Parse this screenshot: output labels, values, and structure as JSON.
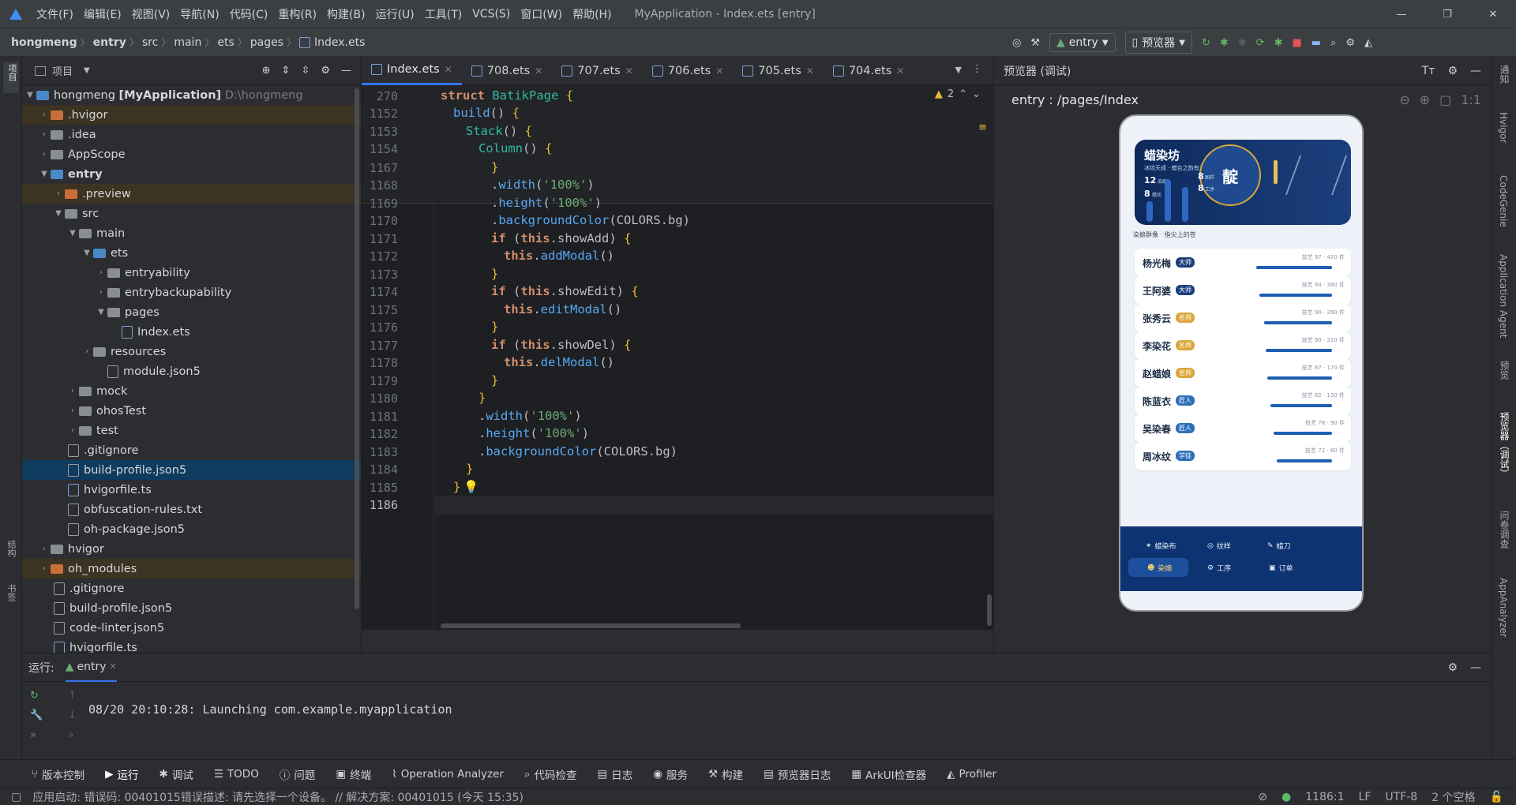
{
  "title_bar": {
    "menu": [
      "文件(F)",
      "编辑(E)",
      "视图(V)",
      "导航(N)",
      "代码(C)",
      "重构(R)",
      "构建(B)",
      "运行(U)",
      "工具(T)",
      "VCS(S)",
      "窗口(W)",
      "帮助(H)"
    ],
    "window_title": "MyApplication - Index.ets [entry]"
  },
  "nav_bar": {
    "breadcrumb": [
      "hongmeng",
      "entry",
      "src",
      "main",
      "ets",
      "pages",
      "Index.ets"
    ],
    "run_config": "entry",
    "device": "预览器"
  },
  "left_stripe": {
    "project_label": "项目",
    "structure_label": "结构",
    "bookmarks_label": "书签"
  },
  "project_panel": {
    "header": "项目",
    "tree": [
      {
        "label": "hongmeng",
        "bold": "[MyApplication]",
        "extra": "D:\\hongmeng"
      },
      {
        "label": ".hvigor"
      },
      {
        "label": ".idea"
      },
      {
        "label": "AppScope"
      },
      {
        "label": "entry"
      },
      {
        "label": ".preview"
      },
      {
        "label": "src"
      },
      {
        "label": "main"
      },
      {
        "label": "ets"
      },
      {
        "label": "entryability"
      },
      {
        "label": "entrybackupability"
      },
      {
        "label": "pages"
      },
      {
        "label": "Index.ets"
      },
      {
        "label": "resources"
      },
      {
        "label": "module.json5"
      },
      {
        "label": "mock"
      },
      {
        "label": "ohosTest"
      },
      {
        "label": "test"
      },
      {
        "label": ".gitignore"
      },
      {
        "label": "build-profile.json5"
      },
      {
        "label": "hvigorfile.ts"
      },
      {
        "label": "obfuscation-rules.txt"
      },
      {
        "label": "oh-package.json5"
      },
      {
        "label": "hvigor"
      },
      {
        "label": "oh_modules"
      },
      {
        "label": ".gitignore"
      },
      {
        "label": "build-profile.json5"
      },
      {
        "label": "code-linter.json5"
      },
      {
        "label": "hvigorfile.ts"
      }
    ]
  },
  "editor_tabs": [
    "Index.ets",
    "708.ets",
    "707.ets",
    "706.ets",
    "705.ets",
    "704.ets"
  ],
  "editor": {
    "warning_count": "2",
    "sticky_lines": [
      {
        "n": "270",
        "text": "struct BatikPage {"
      },
      {
        "n": "1152",
        "text": "build() {"
      },
      {
        "n": "1153",
        "text": "Stack() {"
      },
      {
        "n": "1154",
        "text": "Column() {"
      }
    ],
    "lines": [
      {
        "n": "1167",
        "text": "}"
      },
      {
        "n": "1168",
        "text": ".width('100%')"
      },
      {
        "n": "1169",
        "text": ".height('100%')"
      },
      {
        "n": "1170",
        "text": ".backgroundColor(COLORS.bg)"
      },
      {
        "n": "1171",
        "text": "if (this.showAdd) {"
      },
      {
        "n": "1172",
        "text": "this.addModal()"
      },
      {
        "n": "1173",
        "text": "}"
      },
      {
        "n": "1174",
        "text": "if (this.showEdit) {"
      },
      {
        "n": "1175",
        "text": "this.editModal()"
      },
      {
        "n": "1176",
        "text": "}"
      },
      {
        "n": "1177",
        "text": "if (this.showDel) {"
      },
      {
        "n": "1178",
        "text": "this.delModal()"
      },
      {
        "n": "1179",
        "text": "}"
      },
      {
        "n": "1180",
        "text": "}"
      },
      {
        "n": "1181",
        "text": ".width('100%')"
      },
      {
        "n": "1182",
        "text": ".height('100%')"
      },
      {
        "n": "1183",
        "text": ".backgroundColor(COLORS.bg)"
      },
      {
        "n": "1184",
        "text": "}"
      },
      {
        "n": "1185",
        "text": "}"
      },
      {
        "n": "1186",
        "text": ""
      }
    ]
  },
  "previewer": {
    "header": "预览器 (调试)",
    "path": "entry : /pages/Index",
    "app": {
      "banner_title": "蜡染坊",
      "banner_subtitle": "冰纹天成 · 蜡台之韵有天美",
      "seal": "靛",
      "stats": [
        "12",
        "8",
        "8",
        "8"
      ],
      "stat_labels": [
        "染娘",
        "蜡坊",
        "图样",
        "工序"
      ],
      "section_title": "染娘群像 · 指尖上的苍",
      "artisans": [
        {
          "name": "杨光梅",
          "badge": "大师",
          "badge_color": "#1b3f7c",
          "meta": "技艺 97 · 420 件"
        },
        {
          "name": "王阿婆",
          "badge": "大师",
          "badge_color": "#1b3f7c",
          "meta": "技艺 94 · 380 件"
        },
        {
          "name": "张秀云",
          "badge": "名师",
          "badge_color": "#d9a73a",
          "meta": "技艺 90 · 260 件"
        },
        {
          "name": "李染花",
          "badge": "名师",
          "badge_color": "#d9a73a",
          "meta": "技艺 90 · 210 件"
        },
        {
          "name": "赵蜡娘",
          "badge": "名师",
          "badge_color": "#d9a73a",
          "meta": "技艺 87 · 170 件"
        },
        {
          "name": "陈蓝衣",
          "badge": "匠人",
          "badge_color": "#2d6fb8",
          "meta": "技艺 82 · 130 件"
        },
        {
          "name": "吴染春",
          "badge": "匠人",
          "badge_color": "#2d6fb8",
          "meta": "技艺 78 · 90 件"
        },
        {
          "name": "周冰纹",
          "badge": "学徒",
          "badge_color": "#2d6fb8",
          "meta": "技艺 72 · 60 件"
        }
      ],
      "nav_items": [
        "蜡染布",
        "纹样",
        "蜡刀",
        "染娘",
        "工序",
        "订单"
      ]
    }
  },
  "right_stripe": [
    "通知",
    "Hvigor",
    "CodeGenie",
    "Application Agent",
    "预览",
    "预览器（调试）",
    "问卷调查",
    "AppAnalyzer"
  ],
  "run_panel": {
    "label": "运行:",
    "tab": "entry",
    "console": "08/20 20:10:28: Launching com.example.myapplication"
  },
  "tool_tabs": [
    "版本控制",
    "运行",
    "调试",
    "TODO",
    "问题",
    "终端",
    "Operation Analyzer",
    "代码检查",
    "日志",
    "服务",
    "构建",
    "预览器日志",
    "ArkUI检查器",
    "Profiler"
  ],
  "status_bar": {
    "message": "应用启动: 错误码: 00401015错误描述: 请先选择一个设备。 // 解决方案: 00401015 (今天 15:35)",
    "position": "1186:1",
    "line_sep": "LF",
    "encoding": "UTF-8",
    "indent": "2 个空格"
  }
}
